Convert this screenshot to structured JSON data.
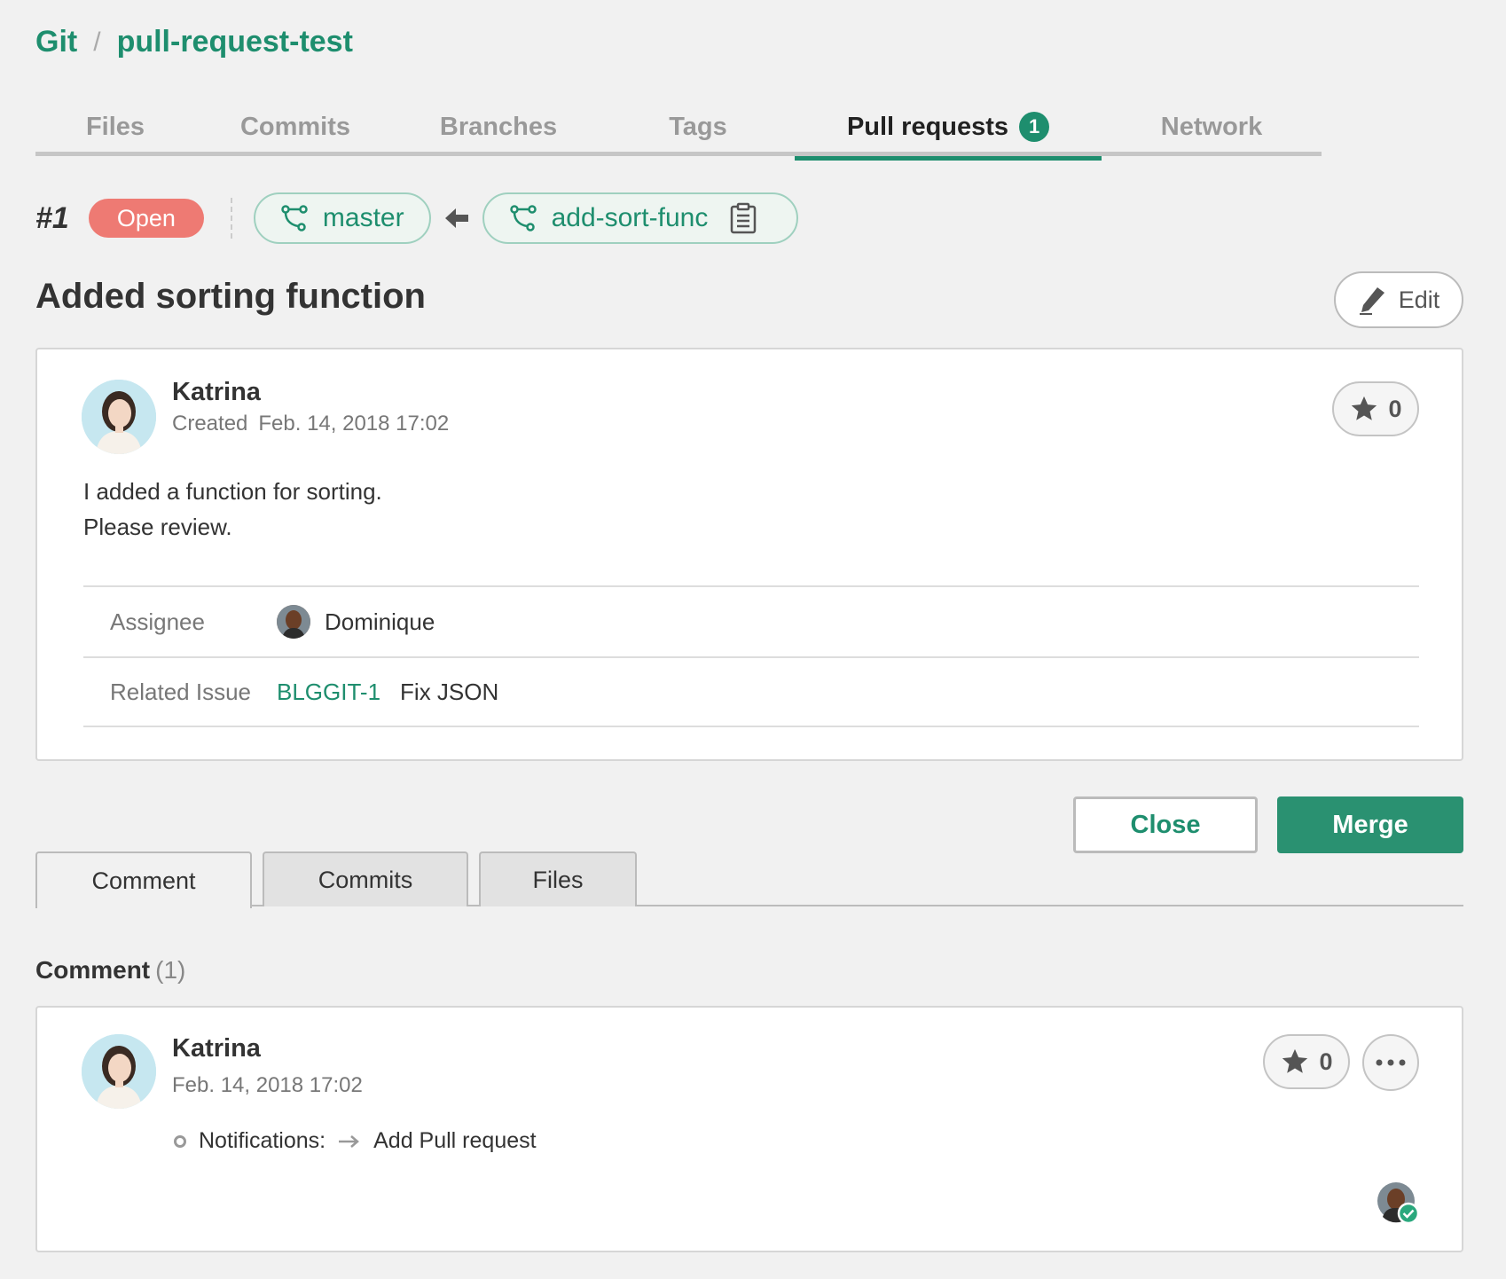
{
  "breadcrumb": {
    "root": "Git",
    "separator": "/",
    "repo": "pull-request-test"
  },
  "top_tabs": [
    {
      "label": "Files"
    },
    {
      "label": "Commits"
    },
    {
      "label": "Branches"
    },
    {
      "label": "Tags"
    },
    {
      "label": "Pull requests",
      "count": "1",
      "active": true
    },
    {
      "label": "Network"
    }
  ],
  "pr": {
    "number": "#1",
    "status": "Open",
    "base_branch": "master",
    "compare_branch": "add-sort-func",
    "title": "Added sorting function",
    "edit_label": "Edit"
  },
  "description": {
    "author": "Katrina",
    "created_label": "Created",
    "created_at": "Feb. 14, 2018 17:02",
    "star_count": "0",
    "body_line1": "I added a function for sorting.",
    "body_line2": "Please review.",
    "assignee_label": "Assignee",
    "assignee": "Dominique",
    "related_issue_label": "Related Issue",
    "related_issue_key": "BLGGIT-1",
    "related_issue_title": "Fix JSON"
  },
  "actions": {
    "close_label": "Close",
    "merge_label": "Merge"
  },
  "sub_tabs": [
    {
      "label": "Comment",
      "active": true
    },
    {
      "label": "Commits"
    },
    {
      "label": "Files"
    }
  ],
  "comments": {
    "heading": "Comment",
    "count": "(1)",
    "items": [
      {
        "author": "Katrina",
        "date": "Feb. 14, 2018 17:02",
        "star_count": "0",
        "notification_label": "Notifications:",
        "notification_text": "Add Pull request"
      }
    ]
  },
  "colors": {
    "accent": "#1e8e6e",
    "open_badge": "#ee7a73",
    "merge_button": "#2a9171"
  },
  "icons": [
    "branch-icon",
    "arrow-left-icon",
    "clipboard-icon",
    "pencil-icon",
    "star-icon",
    "more-icon",
    "arrow-right-icon",
    "check-icon"
  ]
}
